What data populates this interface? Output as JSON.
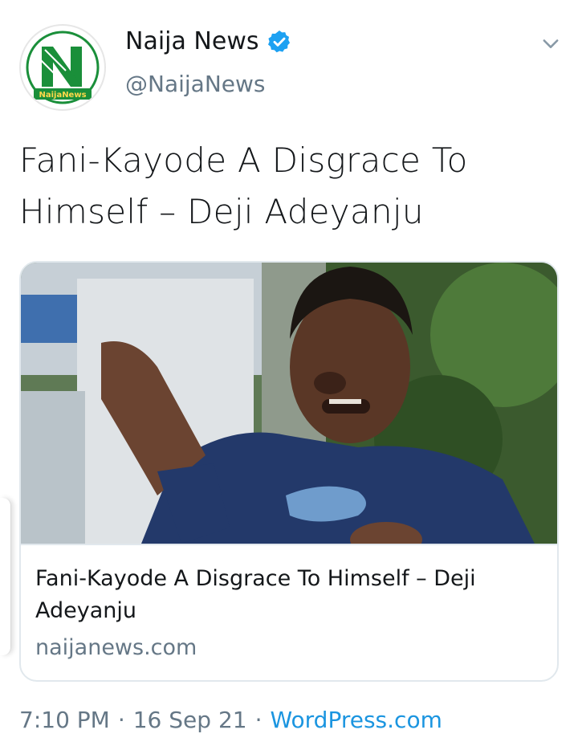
{
  "account": {
    "name": "Naija News",
    "handle": "@NaijaNews",
    "avatar_icon": "naija-news-logo",
    "avatar_logo_text": "NaijaNews",
    "verified_icon": "verified-badge-icon",
    "brand_green": "#1a8f3a",
    "verified_color": "#1da1f2"
  },
  "tweet": {
    "text": "Fani-Kayode A Disgrace To Himself – Deji Adeyanju"
  },
  "card": {
    "title": "Fani-Kayode A Disgrace To Himself – Deji Adeyanju",
    "domain": "naijanews.com",
    "image_icon": "photo-man-pointing"
  },
  "meta": {
    "time": "7:10 PM",
    "sep1": "·",
    "date": "16 Sep 21",
    "sep2": "·",
    "source": "WordPress.com"
  },
  "colors": {
    "text": "#14171a",
    "muted": "#657786",
    "link": "#1b95e0",
    "border": "#e1e8ed"
  }
}
